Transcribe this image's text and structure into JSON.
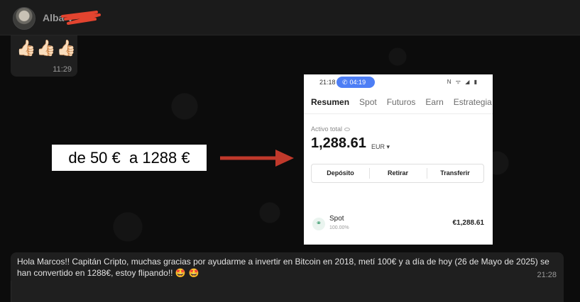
{
  "header": {
    "contact_name": "Alba V"
  },
  "messages": {
    "first": {
      "emojis": "👍🏻👍🏻👍🏻",
      "time": "11:29"
    },
    "last": {
      "text": "Hola Marcos!! Capitán Cripto, muchas gracias por ayudarme a invertir en Bitcoin en 2018, metí 100€ y a día de hoy (26 de Mayo de 2025) se han convertido en 1288€, estoy flipando!! ",
      "emojis": "🤩 🤩",
      "time": "21:28"
    }
  },
  "annotation": {
    "text": "de 50 €  a 1288 €",
    "arrow_color": "#c0392b"
  },
  "screenshot": {
    "status_time": "21:18",
    "call_time": "04:19",
    "status_icons": "N ᯤ ◢ ▮",
    "tabs": [
      "Resumen",
      "Spot",
      "Futuros",
      "Earn",
      "Estrategia"
    ],
    "asset_label": "Activo total",
    "asset_value": "1,288.61",
    "currency": "EUR ▾",
    "actions": [
      "Depósito",
      "Retirar",
      "Transferir"
    ],
    "spot": {
      "name": "Spot",
      "percent": "100.00%",
      "value": "€1,288.61"
    }
  },
  "colors": {
    "call_pill": "#4d7ef5",
    "bubble": "#1f1f1f",
    "scribble": "#e2442f"
  }
}
